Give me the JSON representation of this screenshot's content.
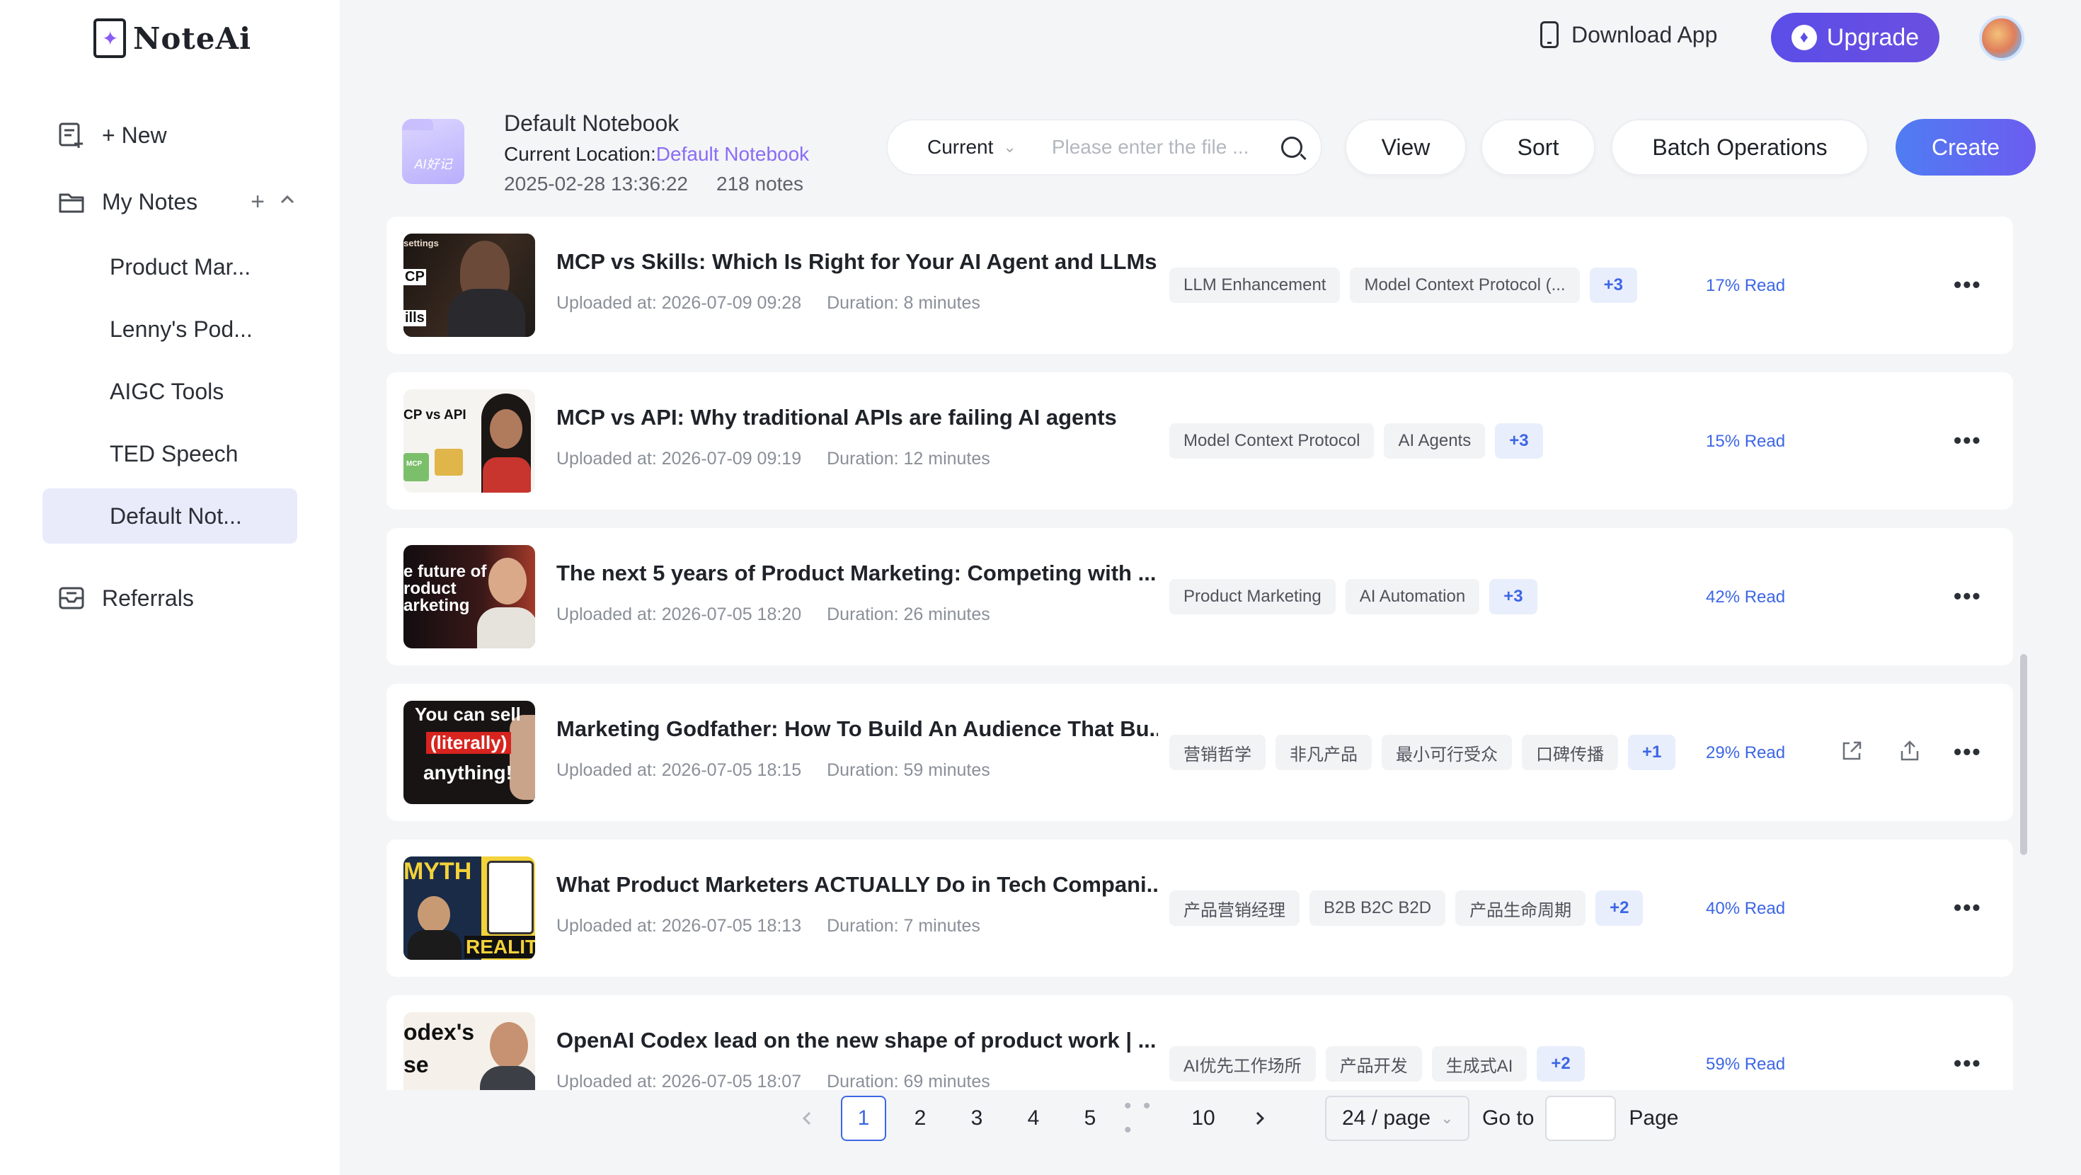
{
  "app": {
    "name": "NoteAi"
  },
  "sidebar": {
    "new_label": "+ New",
    "my_notes_label": "My Notes",
    "folders": [
      {
        "label": "Product Mar..."
      },
      {
        "label": "Lenny's Pod..."
      },
      {
        "label": "AIGC Tools"
      },
      {
        "label": "TED Speech"
      },
      {
        "label": "Default Not...",
        "active": true
      }
    ],
    "referrals_label": "Referrals"
  },
  "topbar": {
    "download_label": "Download App",
    "upgrade_label": "Upgrade"
  },
  "notebook": {
    "icon_text": "AI好记",
    "title": "Default Notebook",
    "location_prefix": "Current Location:",
    "location_link": "Default Notebook",
    "created": "2025-02-28 13:36:22",
    "count": "218 notes"
  },
  "search": {
    "scope": "Current",
    "placeholder": "Please enter the file ..."
  },
  "actions": {
    "view": "View",
    "sort": "Sort",
    "batch": "Batch Operations",
    "create": "Create"
  },
  "notes": [
    {
      "title": "MCP vs Skills: Which Is Right for Your AI Agent and LLMs?",
      "uploaded": "Uploaded at: 2026-07-09 09:28",
      "duration": "Duration: 8 minutes",
      "tags": [
        "LLM Enhancement",
        "Model Context Protocol (..."
      ],
      "more_tags": "+3",
      "progress": "17% Read"
    },
    {
      "title": "MCP vs API: Why traditional APIs are failing AI agents",
      "uploaded": "Uploaded at: 2026-07-09 09:19",
      "duration": "Duration: 12 minutes",
      "tags": [
        "Model Context Protocol",
        "AI Agents"
      ],
      "more_tags": "+3",
      "progress": "15% Read"
    },
    {
      "title": "The next 5 years of Product Marketing: Competing with ...",
      "uploaded": "Uploaded at: 2026-07-05 18:20",
      "duration": "Duration: 26 minutes",
      "tags": [
        "Product Marketing",
        "AI Automation"
      ],
      "more_tags": "+3",
      "progress": "42% Read"
    },
    {
      "title": "Marketing Godfather: How To Build An Audience That Bu...",
      "uploaded": "Uploaded at: 2026-07-05 18:15",
      "duration": "Duration: 59 minutes",
      "tags": [
        "营销哲学",
        "非凡产品",
        "最小可行受众",
        "口碑传播"
      ],
      "more_tags": "+1",
      "progress": "29% Read"
    },
    {
      "title": "What Product Marketers ACTUALLY Do in Tech Compani...",
      "uploaded": "Uploaded at: 2026-07-05 18:13",
      "duration": "Duration: 7 minutes",
      "tags": [
        "产品营销经理",
        "B2B B2C B2D",
        "产品生命周期"
      ],
      "more_tags": "+2",
      "progress": "40% Read"
    },
    {
      "title": "OpenAI Codex lead on the new shape of product work | ...",
      "uploaded": "Uploaded at: 2026-07-05 18:07",
      "duration": "Duration: 69 minutes",
      "tags": [
        "AI优先工作场所",
        "产品开发",
        "生成式AI"
      ],
      "more_tags": "+2",
      "progress": "59% Read"
    }
  ],
  "thumbnails": {
    "t2": "CP vs API",
    "t2b": "MCP",
    "t3": "e future of\nroduct\narketing",
    "t4a": "You can sell",
    "t4b": "(literally)",
    "t4c": "anything!",
    "t5a": "MYTH",
    "t5b": "REALIT",
    "t6a": "odex's",
    "t6b": "se",
    "t1a": "settings",
    "t1b": "CP",
    "t1c": "ills"
  },
  "pagination": {
    "pages": [
      "1",
      "2",
      "3",
      "4",
      "5"
    ],
    "ellipsis": "• • •",
    "last": "10",
    "page_size": "24 / page",
    "goto_label": "Go to",
    "page_label": "Page"
  },
  "colors": {
    "accent": "#3d66e6",
    "upgrade": "#5b4ee8",
    "location_link": "#8a6cf5"
  }
}
